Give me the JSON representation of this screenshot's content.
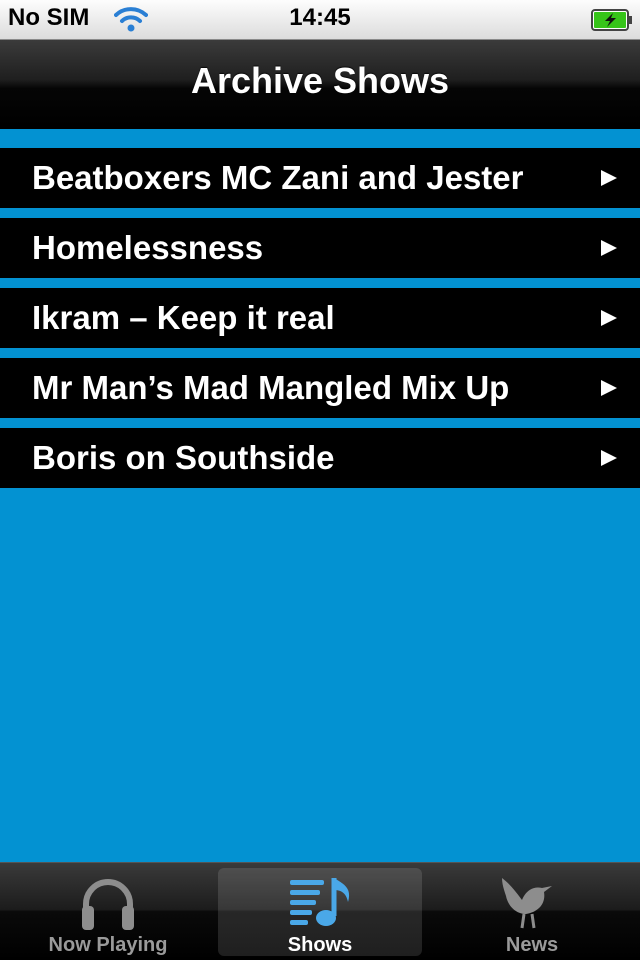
{
  "status_bar": {
    "carrier": "No SIM",
    "time": "14:45",
    "wifi_icon": "wifi-icon",
    "battery_icon": "battery-charging-icon"
  },
  "nav_bar": {
    "title": "Archive Shows"
  },
  "shows": [
    {
      "title": "Beatboxers MC Zani and Jester"
    },
    {
      "title": "Homelessness"
    },
    {
      "title": "Ikram – Keep it real"
    },
    {
      "title": "Mr Man’s Mad Mangled Mix Up"
    },
    {
      "title": "Boris on Southside"
    }
  ],
  "tab_bar": {
    "tabs": [
      {
        "label": "Now Playing",
        "icon": "headphones-icon",
        "selected": false
      },
      {
        "label": "Shows",
        "icon": "music-list-icon",
        "selected": true
      },
      {
        "label": "News",
        "icon": "bird-icon",
        "selected": false
      }
    ]
  },
  "colors": {
    "background": "#0392d2",
    "row": "#000000",
    "tab_selected": "#ffffff",
    "tab_unselected": "#9a9a9a",
    "icon_selected": "#4aa8e8",
    "battery_charge": "#36c419"
  }
}
